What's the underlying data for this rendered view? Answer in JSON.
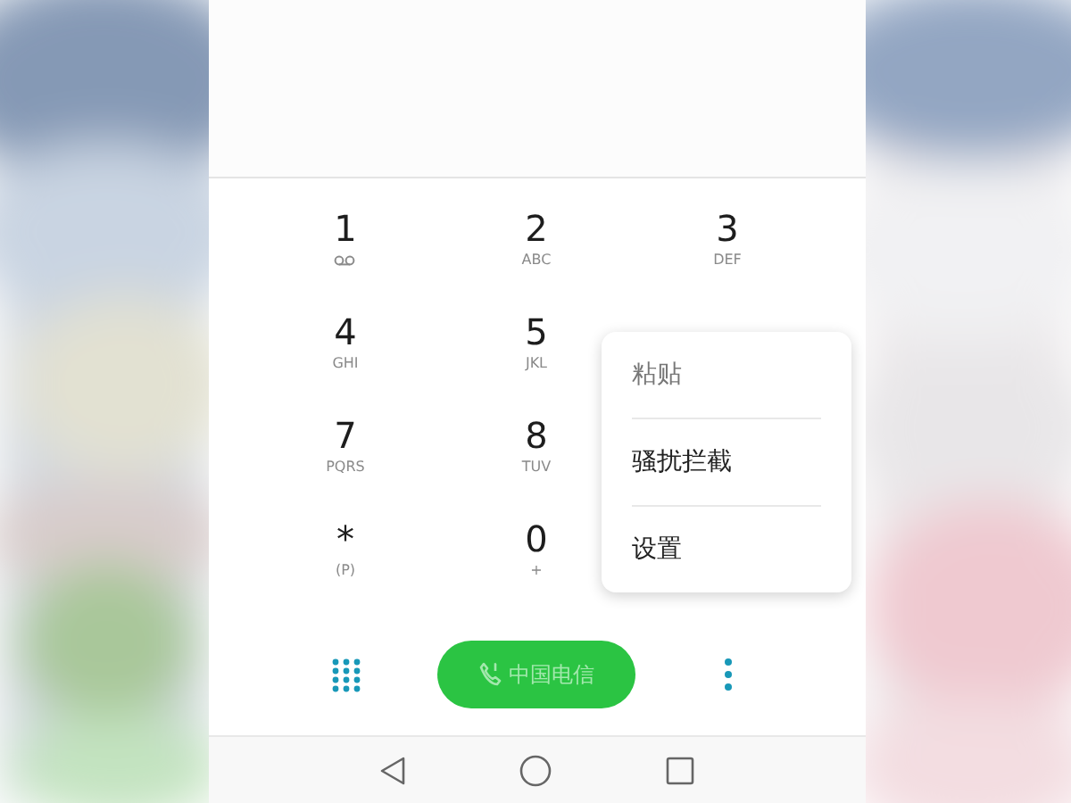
{
  "keypad": {
    "rows": [
      [
        {
          "digit": "1",
          "kind": "voicemail"
        },
        {
          "digit": "2",
          "sub": "ABC",
          "kind": "text"
        },
        {
          "digit": "3",
          "sub": "DEF",
          "kind": "text"
        }
      ],
      [
        {
          "digit": "4",
          "sub": "GHI",
          "kind": "text"
        },
        {
          "digit": "5",
          "sub": "JKL",
          "kind": "text"
        }
      ],
      [
        {
          "digit": "7",
          "sub": "PQRS",
          "kind": "text"
        },
        {
          "digit": "8",
          "sub": "TUV",
          "kind": "text"
        }
      ],
      [
        {
          "digit": "*",
          "sub": "(P)",
          "kind": "text"
        },
        {
          "digit": "0",
          "sub": "+",
          "kind": "text"
        }
      ]
    ]
  },
  "call_button": {
    "label": "中国电信"
  },
  "menu": {
    "items": [
      {
        "label": "粘贴",
        "disabled": true
      },
      {
        "label": "骚扰拦截",
        "disabled": false
      },
      {
        "label": "设置",
        "disabled": false
      }
    ]
  }
}
